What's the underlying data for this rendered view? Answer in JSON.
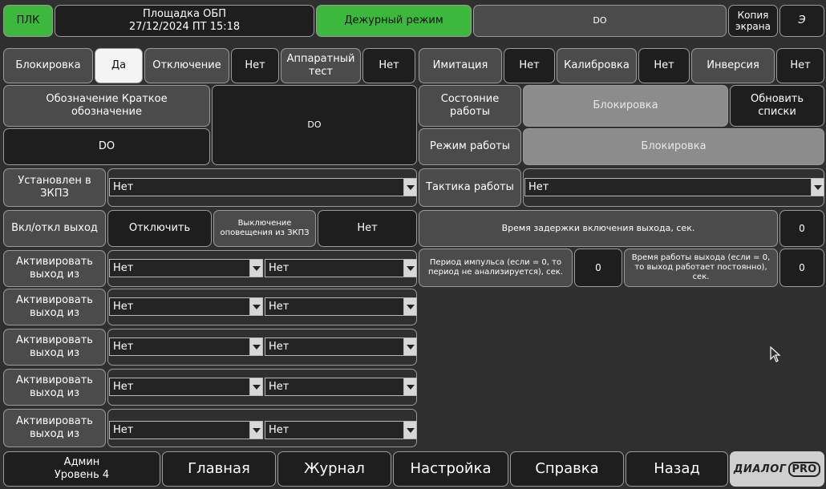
{
  "header": {
    "plc": "ПЛК",
    "site_name": "Площадка ОБП",
    "datetime": "27/12/2024 ПТ 15:18",
    "mode": "Дежурный режим",
    "title": "DO",
    "copy_screen": "Копия экрана",
    "e_button": "Э"
  },
  "flags": [
    {
      "label": "Блокировка",
      "value": "Да"
    },
    {
      "label": "Отключение",
      "value": "Нет"
    },
    {
      "label": "Аппаратный тест",
      "value": "Нет"
    },
    {
      "label": "Имитация",
      "value": "Нет"
    },
    {
      "label": "Калибровка",
      "value": "Нет"
    },
    {
      "label": "Инверсия",
      "value": "Нет"
    }
  ],
  "designation": {
    "label": "Обозначение Краткое обозначение",
    "short_value": "DO",
    "name_value": "DO"
  },
  "status": {
    "state_label": "Состояние работы",
    "state_value": "Блокировка",
    "refresh": "Обновить списки",
    "mode_label": "Режим работы",
    "mode_value": "Блокировка"
  },
  "installed": {
    "label": "Установлен в ЗКПЗ",
    "value": "Нет"
  },
  "tactic": {
    "label": "Тактика работы",
    "value": "Нет"
  },
  "output": {
    "label": "Вкл/откл выход",
    "button": "Отключить",
    "notify_label": "Выключение оповещения из ЗКПЗ",
    "notify_value": "Нет"
  },
  "delay": {
    "label": "Время задержки включения выхода, сек.",
    "value": "0"
  },
  "pulse": {
    "label": "Период импульса (если = 0, то период не анализируется), сек.",
    "value": "0"
  },
  "worktime": {
    "label": "Время работы выхода (если = 0, то выход работает постоянно), сек.",
    "value": "0"
  },
  "activate_rows": [
    {
      "label": "Активировать выход из",
      "a": "Нет",
      "b": "Нет"
    },
    {
      "label": "Активировать выход из",
      "a": "Нет",
      "b": "Нет"
    },
    {
      "label": "Активировать выход из",
      "a": "Нет",
      "b": "Нет"
    },
    {
      "label": "Активировать выход из",
      "a": "Нет",
      "b": "Нет"
    },
    {
      "label": "Активировать выход из",
      "a": "Нет",
      "b": "Нет"
    }
  ],
  "footer": {
    "user": "Админ",
    "level": "Уровень 4",
    "tabs": [
      "Главная",
      "Журнал",
      "Настройка",
      "Справка",
      "Назад"
    ],
    "logo": "ДИАЛОГ",
    "logo_pro": "PRO"
  }
}
